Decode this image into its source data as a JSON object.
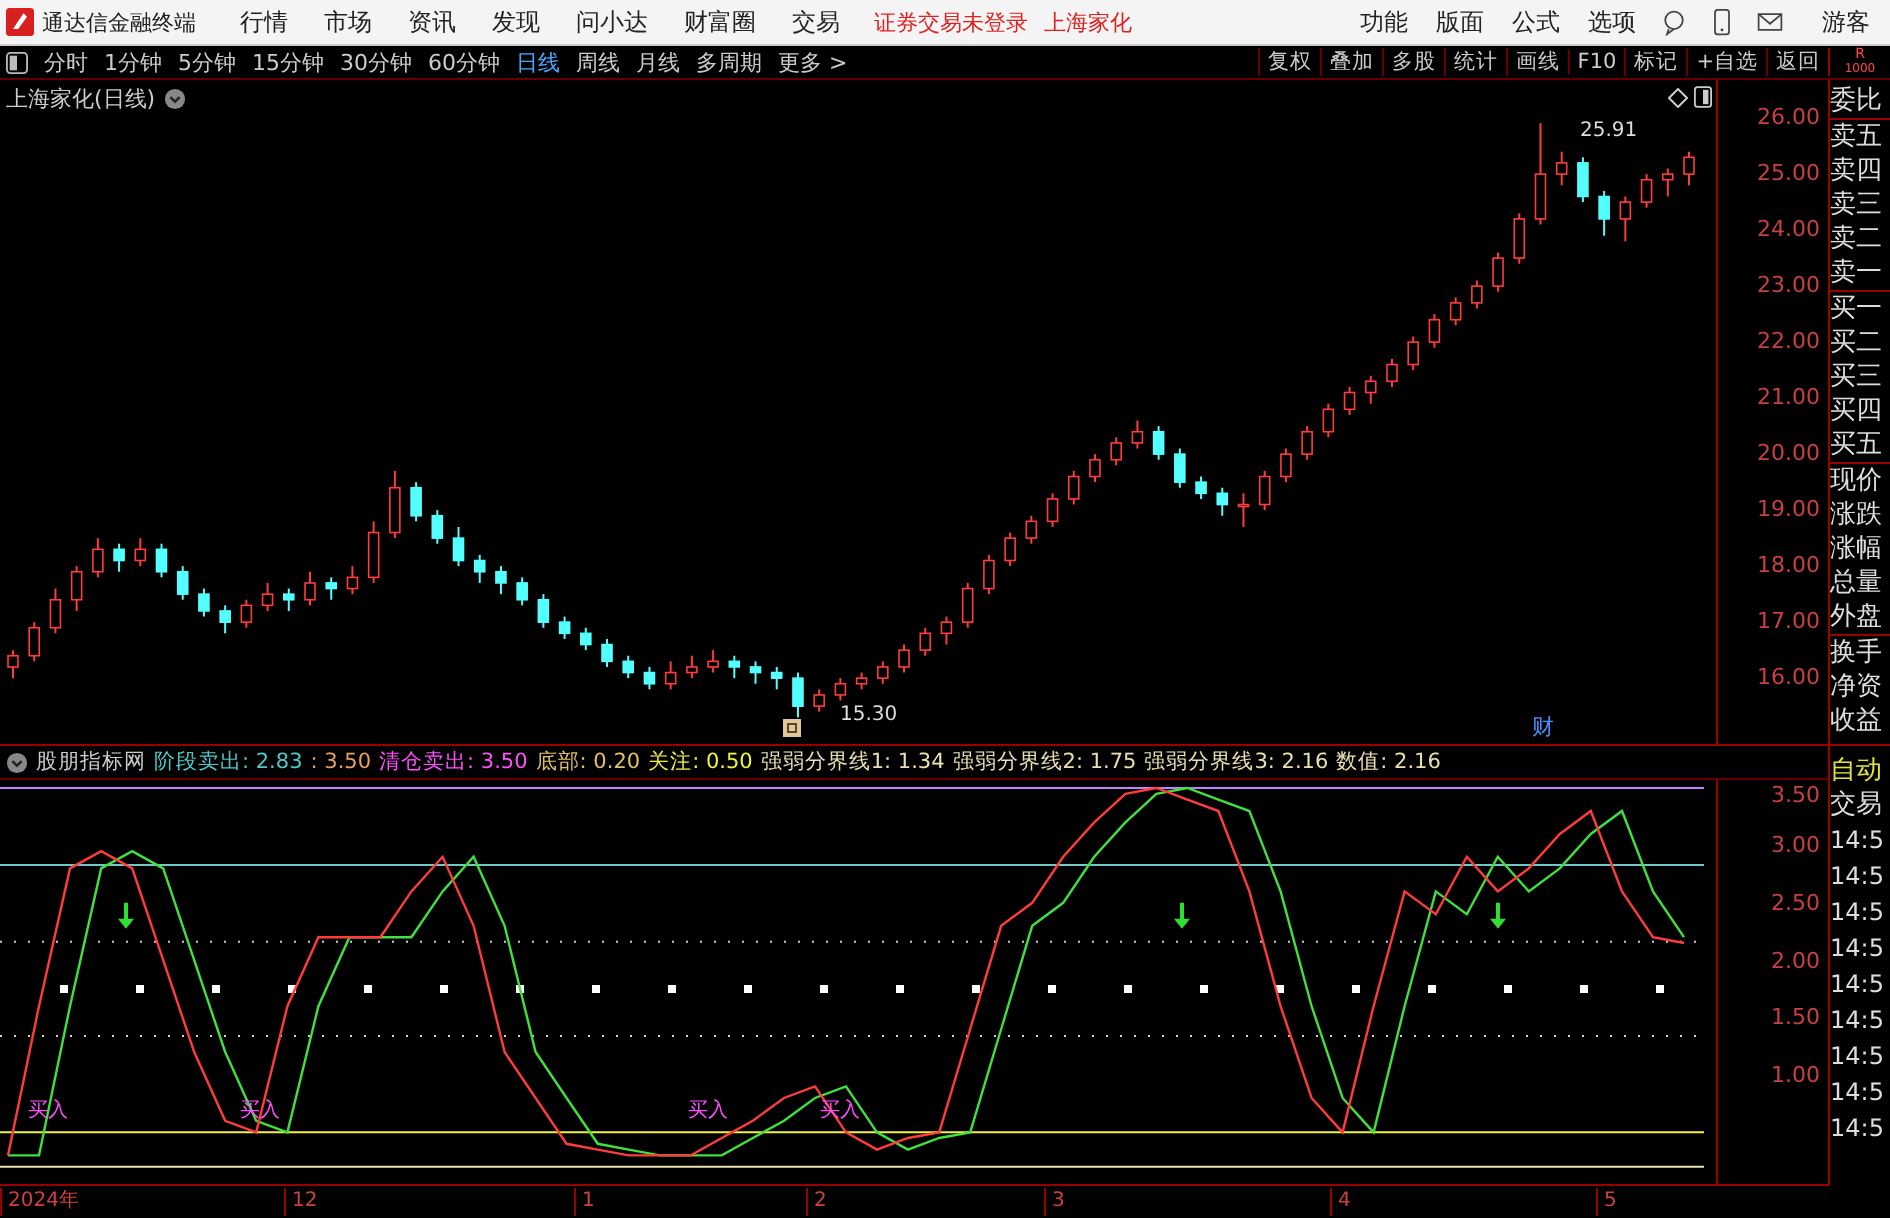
{
  "top_bar": {
    "app_title": "通达信金融终端",
    "menu": [
      "行情",
      "市场",
      "资讯",
      "发现",
      "问小达",
      "财富圈",
      "交易"
    ],
    "notice": "证券交易未登录",
    "stock": "上海家化",
    "right_menu": [
      "功能",
      "版面",
      "公式",
      "选项"
    ],
    "user": "游客"
  },
  "toolbar": {
    "periods": [
      {
        "label": "分时",
        "selected": false
      },
      {
        "label": "1分钟",
        "selected": false
      },
      {
        "label": "5分钟",
        "selected": false
      },
      {
        "label": "15分钟",
        "selected": false
      },
      {
        "label": "30分钟",
        "selected": false
      },
      {
        "label": "60分钟",
        "selected": false
      },
      {
        "label": "日线",
        "selected": true
      },
      {
        "label": "周线",
        "selected": false
      },
      {
        "label": "月线",
        "selected": false
      },
      {
        "label": "多周期",
        "selected": false
      },
      {
        "label": "更多 >",
        "selected": false
      }
    ],
    "actions": [
      "复权",
      "叠加",
      "多股",
      "统计",
      "画线",
      "F10",
      "标记",
      "+自选",
      "返回"
    ]
  },
  "main_chart": {
    "title": "上海家化(日线)",
    "high_label": "25.91",
    "low_label": "15.30",
    "event_marker": "财",
    "chart_data": {
      "type": "candlestick",
      "ylim": [
        14.86,
        26.68
      ],
      "yticks": [
        {
          "value": 26,
          "label": "26.00"
        },
        {
          "value": 25,
          "label": "25.00"
        },
        {
          "value": 24,
          "label": "24.00"
        },
        {
          "value": 23,
          "label": "23.00"
        },
        {
          "value": 22,
          "label": "22.00"
        },
        {
          "value": 21,
          "label": "21.00"
        },
        {
          "value": 20,
          "label": "20.00"
        },
        {
          "value": 19,
          "label": "19.00"
        },
        {
          "value": 18,
          "label": "18.00"
        },
        {
          "value": 17,
          "label": "17.00"
        },
        {
          "value": 16,
          "label": "16.00"
        }
      ],
      "ohlc": [
        [
          16.2,
          16.5,
          16.0,
          16.4
        ],
        [
          16.4,
          17.0,
          16.3,
          16.9
        ],
        [
          16.9,
          17.6,
          16.8,
          17.4
        ],
        [
          17.4,
          18.0,
          17.2,
          17.9
        ],
        [
          17.9,
          18.5,
          17.8,
          18.3
        ],
        [
          18.3,
          18.4,
          17.9,
          18.1
        ],
        [
          18.1,
          18.5,
          18.0,
          18.3
        ],
        [
          18.3,
          18.4,
          17.8,
          17.9
        ],
        [
          17.9,
          18.0,
          17.4,
          17.5
        ],
        [
          17.5,
          17.6,
          17.1,
          17.2
        ],
        [
          17.2,
          17.3,
          16.8,
          17.0
        ],
        [
          17.0,
          17.4,
          16.9,
          17.3
        ],
        [
          17.3,
          17.7,
          17.2,
          17.5
        ],
        [
          17.5,
          17.6,
          17.2,
          17.4
        ],
        [
          17.4,
          17.9,
          17.3,
          17.7
        ],
        [
          17.7,
          17.8,
          17.4,
          17.6
        ],
        [
          17.6,
          18.0,
          17.5,
          17.8
        ],
        [
          17.8,
          18.8,
          17.7,
          18.6
        ],
        [
          18.6,
          19.7,
          18.5,
          19.4
        ],
        [
          19.4,
          19.5,
          18.8,
          18.9
        ],
        [
          18.9,
          19.0,
          18.4,
          18.5
        ],
        [
          18.5,
          18.7,
          18.0,
          18.1
        ],
        [
          18.1,
          18.2,
          17.7,
          17.9
        ],
        [
          17.9,
          18.0,
          17.5,
          17.7
        ],
        [
          17.7,
          17.8,
          17.3,
          17.4
        ],
        [
          17.4,
          17.5,
          16.9,
          17.0
        ],
        [
          17.0,
          17.1,
          16.7,
          16.8
        ],
        [
          16.8,
          16.9,
          16.5,
          16.6
        ],
        [
          16.6,
          16.7,
          16.2,
          16.3
        ],
        [
          16.3,
          16.4,
          16.0,
          16.1
        ],
        [
          16.1,
          16.2,
          15.8,
          15.9
        ],
        [
          15.9,
          16.3,
          15.8,
          16.1
        ],
        [
          16.1,
          16.4,
          16.0,
          16.2
        ],
        [
          16.2,
          16.5,
          16.1,
          16.3
        ],
        [
          16.3,
          16.4,
          16.0,
          16.2
        ],
        [
          16.2,
          16.3,
          15.9,
          16.1
        ],
        [
          16.1,
          16.2,
          15.8,
          16.0
        ],
        [
          16.0,
          16.1,
          15.3,
          15.5
        ],
        [
          15.5,
          15.8,
          15.4,
          15.7
        ],
        [
          15.7,
          16.0,
          15.6,
          15.9
        ],
        [
          15.9,
          16.1,
          15.8,
          16.0
        ],
        [
          16.0,
          16.3,
          15.9,
          16.2
        ],
        [
          16.2,
          16.6,
          16.1,
          16.5
        ],
        [
          16.5,
          16.9,
          16.4,
          16.8
        ],
        [
          16.8,
          17.1,
          16.6,
          17.0
        ],
        [
          17.0,
          17.7,
          16.9,
          17.6
        ],
        [
          17.6,
          18.2,
          17.5,
          18.1
        ],
        [
          18.1,
          18.6,
          18.0,
          18.5
        ],
        [
          18.5,
          18.9,
          18.4,
          18.8
        ],
        [
          18.8,
          19.3,
          18.7,
          19.2
        ],
        [
          19.2,
          19.7,
          19.1,
          19.6
        ],
        [
          19.6,
          20.0,
          19.5,
          19.9
        ],
        [
          19.9,
          20.3,
          19.8,
          20.2
        ],
        [
          20.2,
          20.6,
          20.1,
          20.4
        ],
        [
          20.4,
          20.5,
          19.9,
          20.0
        ],
        [
          20.0,
          20.1,
          19.4,
          19.5
        ],
        [
          19.5,
          19.6,
          19.2,
          19.3
        ],
        [
          19.3,
          19.4,
          18.9,
          19.1
        ],
        [
          19.1,
          19.3,
          18.7,
          19.1
        ],
        [
          19.1,
          19.7,
          19.0,
          19.6
        ],
        [
          19.6,
          20.1,
          19.5,
          20.0
        ],
        [
          20.0,
          20.5,
          19.9,
          20.4
        ],
        [
          20.4,
          20.9,
          20.3,
          20.8
        ],
        [
          20.8,
          21.2,
          20.7,
          21.1
        ],
        [
          21.1,
          21.4,
          20.9,
          21.3
        ],
        [
          21.3,
          21.7,
          21.2,
          21.6
        ],
        [
          21.6,
          22.1,
          21.5,
          22.0
        ],
        [
          22.0,
          22.5,
          21.9,
          22.4
        ],
        [
          22.4,
          22.8,
          22.3,
          22.7
        ],
        [
          22.7,
          23.1,
          22.6,
          23.0
        ],
        [
          23.0,
          23.6,
          22.9,
          23.5
        ],
        [
          23.5,
          24.3,
          23.4,
          24.2
        ],
        [
          24.2,
          25.91,
          24.1,
          25.0
        ],
        [
          25.0,
          25.4,
          24.8,
          25.2
        ],
        [
          25.2,
          25.3,
          24.5,
          24.6
        ],
        [
          24.6,
          24.7,
          23.9,
          24.2
        ],
        [
          24.2,
          24.6,
          23.8,
          24.5
        ],
        [
          24.5,
          25.0,
          24.4,
          24.9
        ],
        [
          24.9,
          25.1,
          24.6,
          25.0
        ],
        [
          25.0,
          25.4,
          24.8,
          25.3
        ]
      ]
    }
  },
  "indicator": {
    "name": "股朋指标网",
    "readouts": [
      {
        "text": "阶段卖出: 2.83",
        "color": "#4fc8c8"
      },
      {
        "text": ": 3.50",
        "color": "#e8a060"
      },
      {
        "text": "清仓卖出: 3.50",
        "color": "#ff50ff"
      },
      {
        "text": "底部: 0.20",
        "color": "#e0c070"
      },
      {
        "text": "关注: 0.50",
        "color": "#f0f040"
      },
      {
        "text": "强弱分界线1: 1.34",
        "color": "#e8e0b0"
      },
      {
        "text": "强弱分界线2: 1.75",
        "color": "#e8e0b0"
      },
      {
        "text": "强弱分界线3: 2.16",
        "color": "#e8e0b0"
      },
      {
        "text": "数值: 2.16",
        "color": "#e8e0b0"
      }
    ],
    "buy_markers": [
      "买入",
      "买入",
      "买入",
      "买入"
    ],
    "chart_data": {
      "type": "line",
      "ylim": [
        0.05,
        3.57
      ],
      "ref_lines": [
        {
          "axis": "y",
          "value": 3.5,
          "color": "#c080ff"
        },
        {
          "axis": "y",
          "value": 2.83,
          "color": "#70c8c8"
        },
        {
          "axis": "y",
          "value": 2.16,
          "color": "#cccccc"
        },
        {
          "axis": "y",
          "value": 1.75,
          "color": "#ffffff"
        },
        {
          "axis": "y",
          "value": 1.34,
          "color": "#cccccc"
        },
        {
          "axis": "y",
          "value": 0.5,
          "color": "#f0f040"
        },
        {
          "axis": "y",
          "value": 0.2,
          "color": "#e8e0b0"
        }
      ],
      "yticks": [
        {
          "value": 3.5,
          "label": "3.50"
        },
        {
          "value": 3,
          "label": "3.00"
        },
        {
          "value": 2.5,
          "label": "2.50"
        },
        {
          "value": 2,
          "label": "2.00"
        },
        {
          "value": 1.5,
          "label": "1.50"
        },
        {
          "value": 1,
          "label": "1.00"
        }
      ],
      "series": [
        {
          "color": "#ff3c3c",
          "values": [
            0.3,
            1.6,
            2.8,
            2.95,
            2.8,
            2.0,
            1.2,
            0.6,
            0.5,
            1.6,
            2.2,
            2.2,
            2.2,
            2.6,
            2.9,
            2.3,
            1.2,
            0.8,
            0.4,
            0.35,
            0.3,
            0.3,
            0.3,
            0.45,
            0.6,
            0.8,
            0.9,
            0.5,
            0.35,
            0.45,
            0.5,
            1.4,
            2.3,
            2.5,
            2.9,
            3.2,
            3.45,
            3.5,
            3.4,
            3.3,
            2.6,
            1.6,
            0.8,
            0.5,
            1.6,
            2.6,
            2.4,
            2.9,
            2.6,
            2.8,
            3.1,
            3.3,
            2.6,
            2.2,
            2.15
          ]
        },
        {
          "color": "#40e040",
          "values": [
            0.3,
            0.3,
            1.6,
            2.8,
            2.95,
            2.8,
            2.0,
            1.2,
            0.6,
            0.5,
            1.6,
            2.2,
            2.2,
            2.2,
            2.6,
            2.9,
            2.3,
            1.2,
            0.8,
            0.4,
            0.35,
            0.3,
            0.3,
            0.3,
            0.45,
            0.6,
            0.8,
            0.9,
            0.5,
            0.35,
            0.45,
            0.5,
            1.4,
            2.3,
            2.5,
            2.9,
            3.2,
            3.45,
            3.5,
            3.4,
            3.3,
            2.6,
            1.6,
            0.8,
            0.5,
            1.6,
            2.6,
            2.4,
            2.9,
            2.6,
            2.8,
            3.1,
            3.3,
            2.6,
            2.2
          ]
        }
      ]
    }
  },
  "x_axis": [
    "2024年",
    "12",
    "1",
    "2",
    "3",
    "4",
    "5"
  ],
  "side_panel": {
    "header": [
      "R",
      "1000"
    ],
    "quote_labels": [
      "委比",
      "卖五",
      "卖四",
      "卖三",
      "卖二",
      "卖一",
      "买一",
      "买二",
      "买三",
      "买四",
      "买五",
      "现价",
      "涨跌",
      "涨幅",
      "总量",
      "外盘",
      "换手",
      "净资",
      "收益"
    ],
    "auto_label": "自动",
    "trade_label": "交易",
    "times": [
      "14:5",
      "14:5",
      "14:5",
      "14:5",
      "14:5",
      "14:5",
      "14:5",
      "14:5",
      "14:5"
    ]
  }
}
